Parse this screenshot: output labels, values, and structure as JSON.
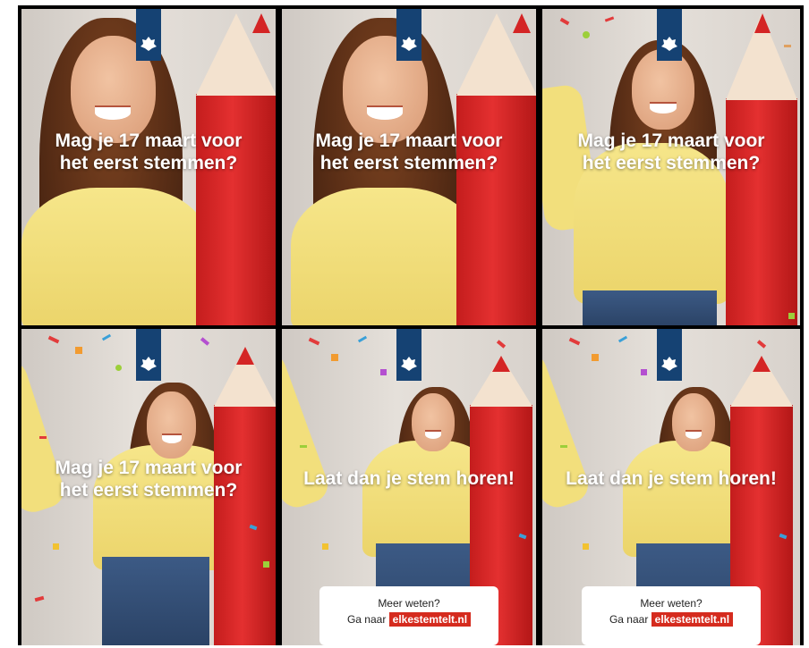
{
  "banners": [
    {
      "headline_1": "Mag je 17 maart voor",
      "headline_2": "het eerst stemmen?",
      "has_cta": false
    },
    {
      "headline_1": "Mag je 17 maart voor",
      "headline_2": "het eerst stemmen?",
      "has_cta": false
    },
    {
      "headline_1": "Mag je 17 maart voor",
      "headline_2": "het eerst stemmen?",
      "has_cta": false
    },
    {
      "headline_1": "Mag je 17 maart voor",
      "headline_2": "het eerst stemmen?",
      "has_cta": false
    },
    {
      "headline_1": "Laat dan je stem horen!",
      "headline_2": "",
      "has_cta": true
    },
    {
      "headline_1": "Laat dan je stem horen!",
      "headline_2": "",
      "has_cta": true
    }
  ],
  "cta": {
    "question": "Meer weten?",
    "prefix": "Ga naar",
    "url_text": "elkestemtelt.nl"
  },
  "colors": {
    "logo_blue": "#154273",
    "pencil_red": "#d52b1e",
    "sweater_yellow": "#f6e68a"
  },
  "logo_icon": "rijksoverheid-crest-icon"
}
